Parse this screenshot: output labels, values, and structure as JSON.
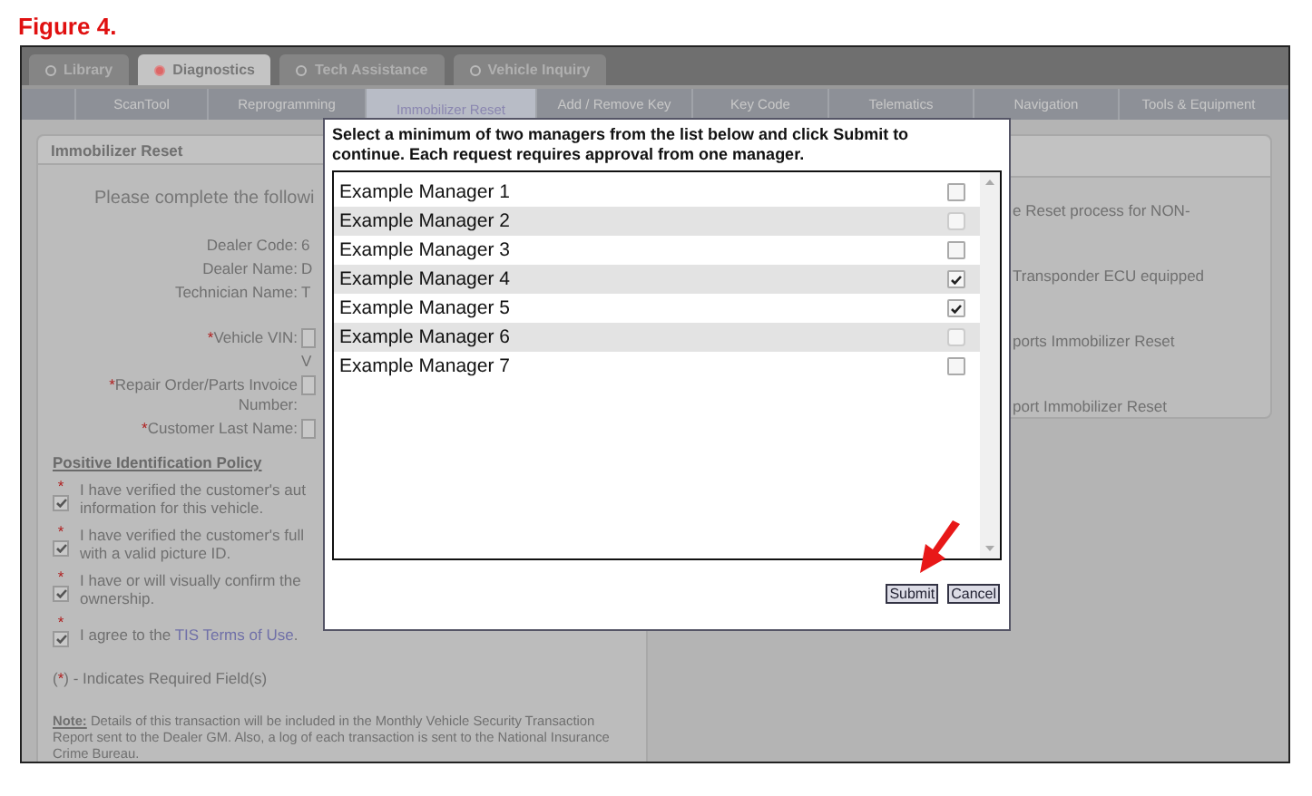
{
  "figure_title": "Figure 4.",
  "main_tabs": [
    {
      "label": "Library",
      "selected": false
    },
    {
      "label": "Diagnostics",
      "selected": true
    },
    {
      "label": "Tech Assistance",
      "selected": false
    },
    {
      "label": "Vehicle Inquiry",
      "selected": false
    }
  ],
  "sub_tabs": [
    {
      "label": "ScanTool",
      "selected": false
    },
    {
      "label": "Reprogramming",
      "selected": false
    },
    {
      "label": "Immobilizer Reset",
      "selected": true
    },
    {
      "label": "Add / Remove Key",
      "selected": false
    },
    {
      "label": "Key Code",
      "selected": false
    },
    {
      "label": "Telematics",
      "selected": false
    },
    {
      "label": "Navigation",
      "selected": false
    },
    {
      "label": "Tools & Equipment",
      "selected": false
    }
  ],
  "left_panel": {
    "title": "Immobilizer Reset",
    "intro": "Please complete the followi",
    "fields": [
      {
        "kind": "info",
        "label": "Dealer Code:",
        "value": "6"
      },
      {
        "kind": "info",
        "label": "Dealer Name:",
        "value": "D"
      },
      {
        "kind": "info",
        "label": "Technician Name:",
        "value": "T"
      },
      {
        "kind": "input",
        "mark": "*",
        "label": "Vehicle VIN:",
        "hint": "V"
      },
      {
        "kind": "input",
        "mark": "*",
        "label": "Repair Order/Parts Invoice Number:"
      },
      {
        "kind": "input",
        "mark": "*",
        "label": "Customer Last Name:"
      }
    ],
    "policy_title": "Positive Identification Policy",
    "policy_items": [
      {
        "mark": "*",
        "checked": true,
        "lines": [
          "I have verified the customer's aut",
          "information for this vehicle."
        ]
      },
      {
        "mark": "*",
        "checked": true,
        "lines": [
          "I have verified the customer's full",
          "with a valid picture ID."
        ]
      },
      {
        "mark": "*",
        "checked": true,
        "lines": [
          "I have or will visually confirm the",
          "ownership."
        ]
      },
      {
        "mark": "*",
        "checked": true,
        "text": "I agree to the ",
        "link": "TIS Terms of Use",
        "after": "."
      }
    ],
    "legend": {
      "open": "(",
      "mark": "*",
      "rest": ") - Indicates Required Field(s)"
    },
    "note": "**Note:** Details of this transaction will be included in the Monthly Vehicle Security Transaction Report sent to the Dealer GM. Also, a log of each transaction is sent to the National Insurance Crime Bureau."
  },
  "right_panel": {
    "lines": [
      "e Reset process for NON-",
      "Transponder ECU equipped",
      "ports Immobilizer Reset",
      "port Immobilizer Reset"
    ]
  },
  "dialog": {
    "message": "Select a minimum of two managers from the list below and click Submit to continue. Each request requires approval from one manager.",
    "managers": [
      {
        "name": "Example Manager 1",
        "checked": false,
        "disabled": false
      },
      {
        "name": "Example Manager 2",
        "checked": false,
        "disabled": true
      },
      {
        "name": "Example Manager 3",
        "checked": false,
        "disabled": false
      },
      {
        "name": "Example Manager 4",
        "checked": true,
        "disabled": false
      },
      {
        "name": "Example Manager 5",
        "checked": true,
        "disabled": false
      },
      {
        "name": "Example Manager 6",
        "checked": false,
        "disabled": true
      },
      {
        "name": "Example Manager 7",
        "checked": false,
        "disabled": false
      }
    ],
    "buttons": [
      "Submit",
      "Cancel"
    ]
  }
}
